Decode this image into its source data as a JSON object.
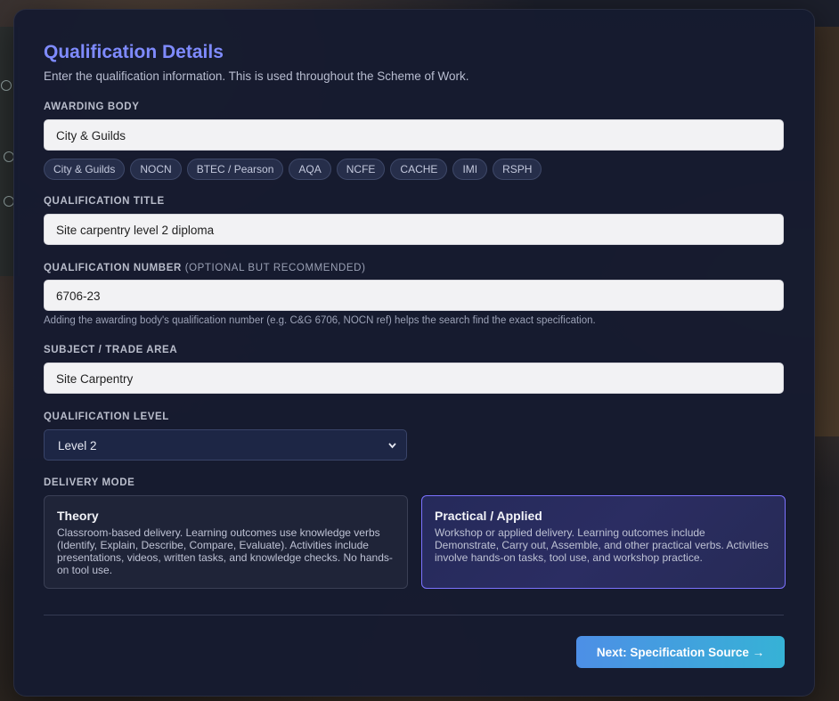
{
  "page": {
    "title": "Qualification Details",
    "subtitle": "Enter the qualification information. This is used throughout the Scheme of Work."
  },
  "awarding_body": {
    "label": "AWARDING BODY",
    "value": "City & Guilds",
    "chips": [
      "City & Guilds",
      "NOCN",
      "BTEC / Pearson",
      "AQA",
      "NCFE",
      "CACHE",
      "IMI",
      "RSPH"
    ]
  },
  "qualification_title": {
    "label": "QUALIFICATION TITLE",
    "value": "Site carpentry level 2 diploma"
  },
  "qualification_number": {
    "label": "QUALIFICATION NUMBER",
    "optional_note": "(OPTIONAL BUT RECOMMENDED)",
    "value": "6706-23",
    "hint": "Adding the awarding body's qualification number (e.g. C&G 6706, NOCN ref) helps the search find the exact specification."
  },
  "subject": {
    "label": "SUBJECT / TRADE AREA",
    "value": "Site Carpentry"
  },
  "qualification_level": {
    "label": "QUALIFICATION LEVEL",
    "selected": "Level 2"
  },
  "delivery_mode": {
    "label": "DELIVERY MODE",
    "options": [
      {
        "title": "Theory",
        "description": "Classroom-based delivery. Learning outcomes use knowledge verbs (Identify, Explain, Describe, Compare, Evaluate). Activities include presentations, videos, written tasks, and knowledge checks. No hands-on tool use.",
        "selected": false
      },
      {
        "title": "Practical / Applied",
        "description": "Workshop or applied delivery. Learning outcomes include Demonstrate, Carry out, Assemble, and other practical verbs. Activities involve hands-on tasks, tool use, and workshop practice.",
        "selected": true
      }
    ]
  },
  "actions": {
    "next_label": "Next: Specification Source →"
  },
  "colors": {
    "accent": "#7f8bff",
    "card_bg": "#161b30",
    "selected_border": "#7c72ff",
    "button_gradient_start": "#4d8fe6",
    "button_gradient_end": "#36b2d6"
  },
  "icons": {
    "select_chevron": "chevron-down-icon"
  }
}
